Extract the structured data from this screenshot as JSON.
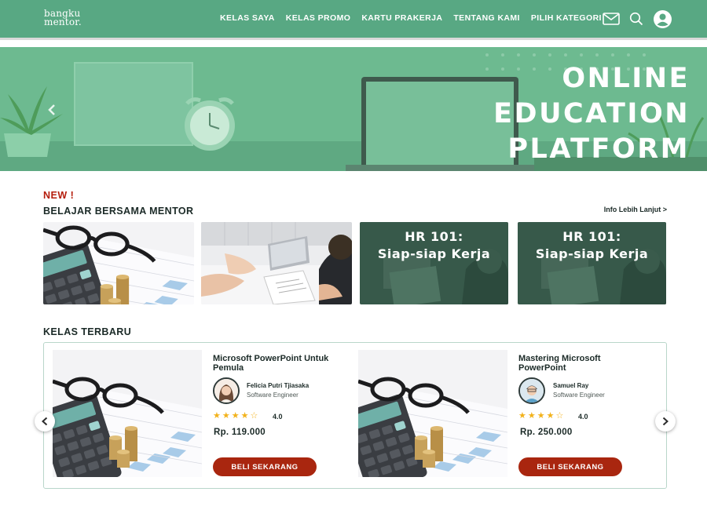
{
  "header": {
    "logo_line1": "bangku",
    "logo_line2": "mentor.",
    "nav": [
      "KELAS SAYA",
      "KELAS PROMO",
      "KARTU PRAKERJA",
      "TENTANG KAMI",
      "PILIH KATEGORI"
    ],
    "icons": [
      "mail-icon",
      "search-icon",
      "user-icon"
    ]
  },
  "hero": {
    "line1": "ONLINE",
    "line2": "EDUCATION",
    "line3": "PLATFORM"
  },
  "mentor_section": {
    "badge": "NEW !",
    "title": "BELAJAR BERSAMA MENTOR",
    "link": "Info Lebih Lanjut >",
    "tiles": [
      {
        "kind": "calculator-photo"
      },
      {
        "kind": "interview-photo"
      },
      {
        "line1": "HR 101:",
        "line2": "Siap-siap Kerja"
      },
      {
        "line1": "HR 101:",
        "line2": "Siap-siap Kerja"
      }
    ]
  },
  "courses_section": {
    "title": "KELAS TERBARU",
    "courses": [
      {
        "title_line1": "Microsoft PowerPoint Untuk",
        "title_line2": "Pemula",
        "mentor": "Felicia Putri Tjiasaka",
        "role": "Software Engineer",
        "stars": "★★★★☆",
        "rating": "4.0",
        "price": "Rp. 119.000",
        "button": "BELI SEKARANG"
      },
      {
        "title_line1": "Mastering Microsoft",
        "title_line2": "PowerPoint",
        "mentor": "Samuel Ray",
        "role": "Software Engineer",
        "stars": "★★★★☆",
        "rating": "4.0",
        "price": "Rp. 250.000",
        "button": "BELI SEKARANG"
      }
    ]
  },
  "colors": {
    "brand_green": "#58a883",
    "button_red": "#a9260f",
    "badge_red": "#b51d0c",
    "star_yellow": "#f2b21b"
  }
}
